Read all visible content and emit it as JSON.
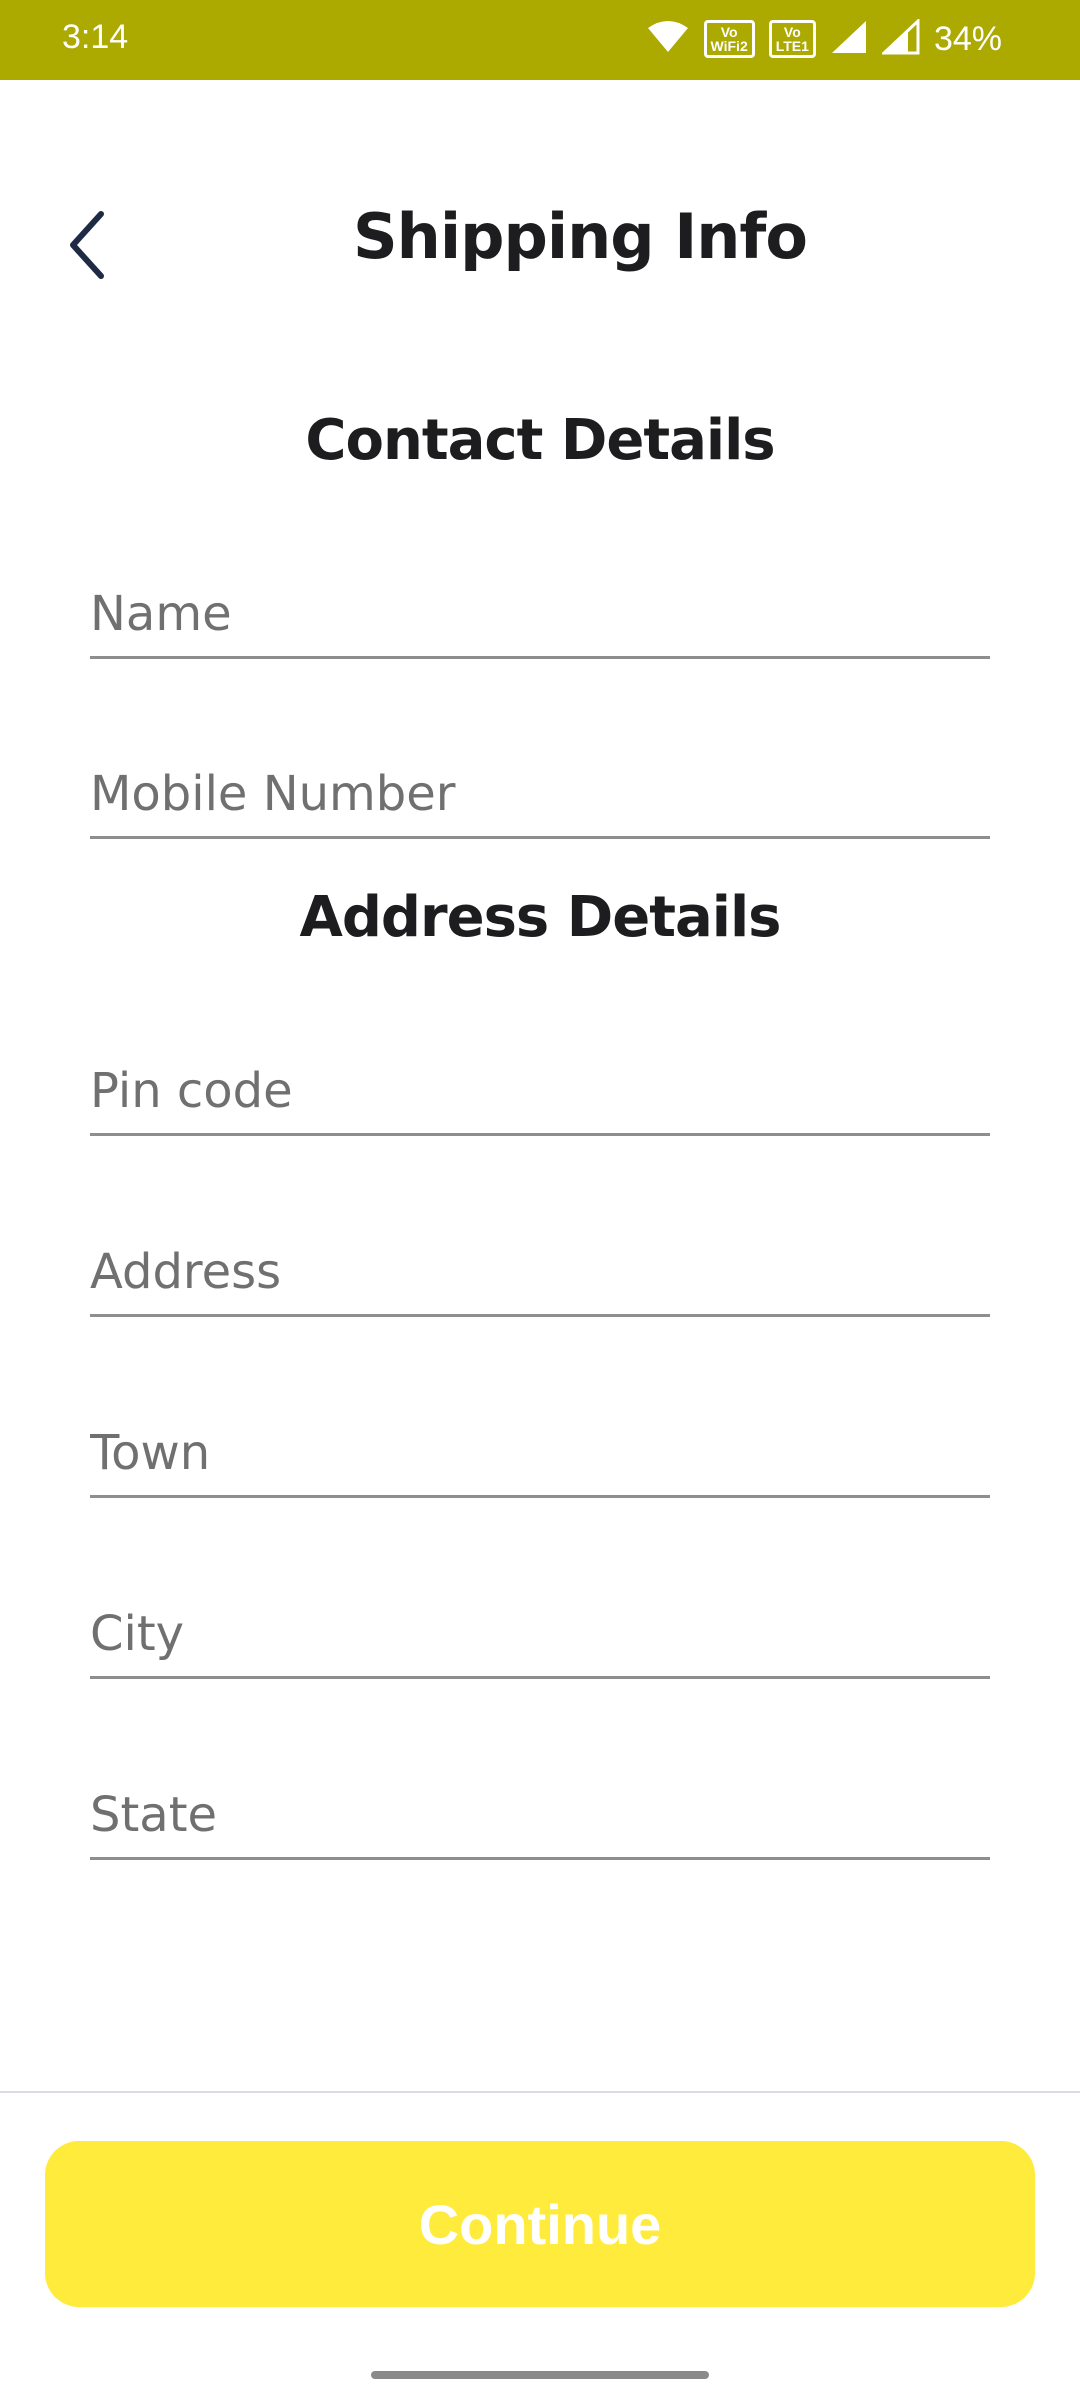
{
  "status_bar": {
    "time": "3:14",
    "wifi_calling_label": "Vo\nWiFi2",
    "volte_label": "Vo\nLTE1",
    "battery": "34%"
  },
  "header": {
    "title": "Shipping Info",
    "back_icon": "chevron-left-icon"
  },
  "contact_section": {
    "heading": "Contact Details",
    "fields": [
      {
        "placeholder": "Name",
        "value": ""
      },
      {
        "placeholder": "Mobile Number",
        "value": ""
      }
    ]
  },
  "address_section": {
    "heading": "Address Details",
    "fields": [
      {
        "placeholder": "Pin code",
        "value": ""
      },
      {
        "placeholder": "Address",
        "value": ""
      },
      {
        "placeholder": "Town",
        "value": ""
      },
      {
        "placeholder": "City",
        "value": ""
      },
      {
        "placeholder": "State",
        "value": ""
      }
    ]
  },
  "footer": {
    "continue_label": "Continue"
  },
  "colors": {
    "status_bar": "#aca900",
    "accent_button": "#ffeb3b",
    "text_primary": "#1d1d1f",
    "placeholder": "#707070",
    "underline": "#8e8e8e"
  }
}
